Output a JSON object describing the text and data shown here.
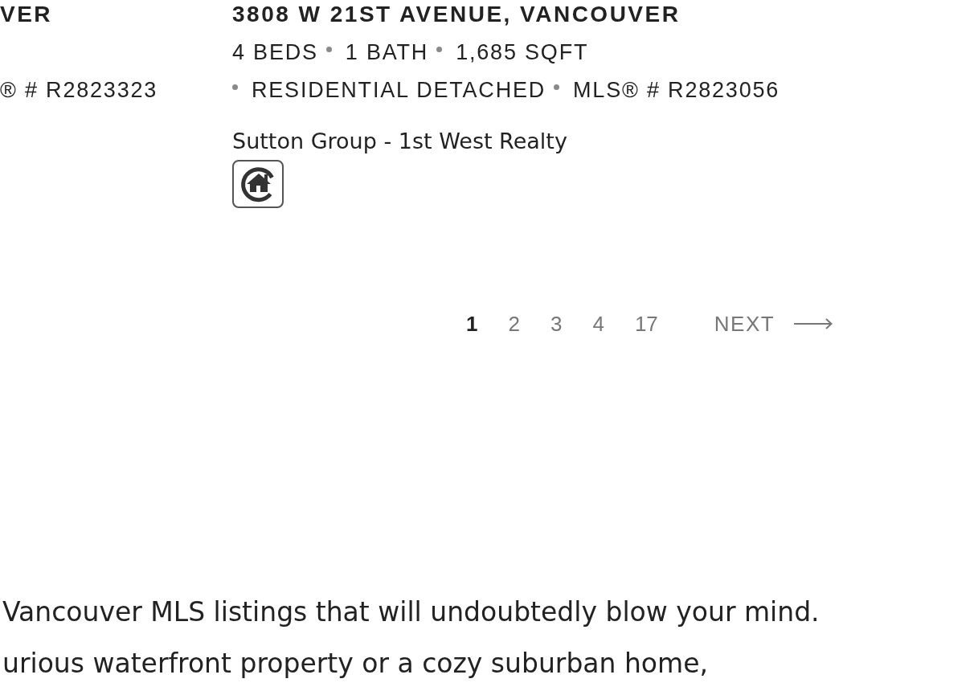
{
  "listings": [
    {
      "address": "VER",
      "specs": [
        "® # R2823323"
      ]
    },
    {
      "address": "3808 W 21ST AVENUE, VANCOUVER",
      "specs": [
        "4 BEDS",
        "1 BATH",
        "1,685 SQFT",
        "RESIDENTIAL DETACHED",
        "MLS® # R2823056"
      ],
      "brokerage": "Sutton Group - 1st West Realty",
      "logo": true
    }
  ],
  "pagination": {
    "pages": [
      {
        "label": "1",
        "selected": true
      },
      {
        "label": "2",
        "selected": false
      },
      {
        "label": "3",
        "selected": false
      },
      {
        "label": "4",
        "selected": false
      },
      {
        "label": "17",
        "selected": false
      }
    ],
    "next": "NEXT"
  },
  "intro": {
    "lines": [
      "Vancouver MLS listings that will undoubtedly blow your mind.",
      "urious waterfront property or a cozy suburban home,"
    ]
  }
}
